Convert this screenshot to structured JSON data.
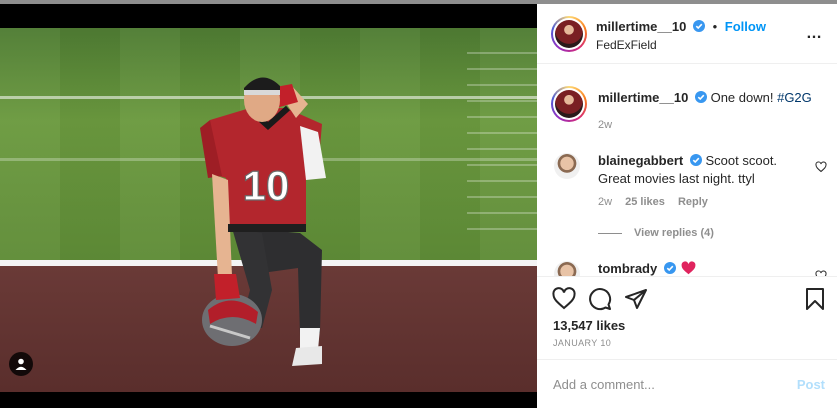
{
  "post": {
    "author": "millertime__10",
    "follow_label": "Follow",
    "location": "FedExField",
    "caption_text": "One down!",
    "caption_hashtag": "#G2G",
    "caption_age": "2w",
    "likes": "13,547 likes",
    "date": "JANUARY 10",
    "jersey_number": "10"
  },
  "comments": [
    {
      "user": "blainegabbert",
      "text_line1": "Scoot scoot.",
      "text_line2": "Great movies last night. ttyl",
      "age": "2w",
      "likes": "25 likes",
      "reply_label": "Reply",
      "view_replies": "View replies (4)"
    },
    {
      "user": "tombrady"
    }
  ],
  "composer": {
    "placeholder": "Add a comment...",
    "post_label": "Post"
  },
  "colors": {
    "accent": "#0095f6",
    "verified": "#3897f0",
    "hashtag": "#00376b",
    "muted": "#8e8e8e",
    "post_disabled": "#b2dffc",
    "heart_emoji": "#e0245e"
  }
}
